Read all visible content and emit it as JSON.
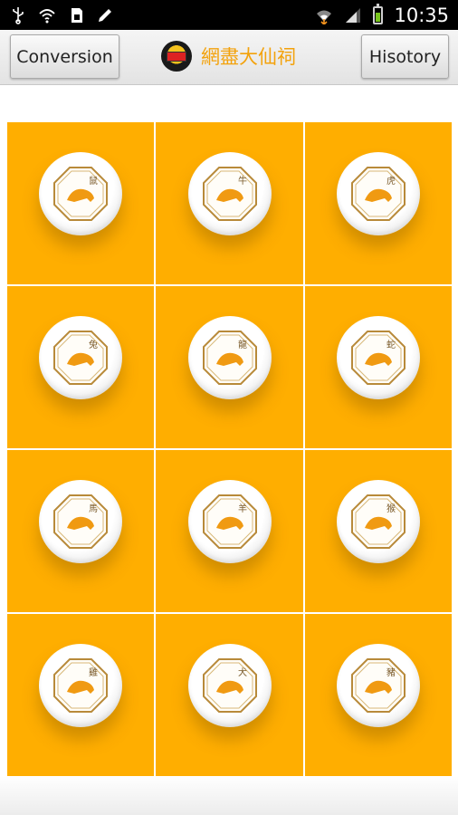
{
  "status_bar": {
    "time": "10:35",
    "icons": [
      "usb-icon",
      "wifi-icon",
      "sd-card-icon",
      "pencil-icon",
      "wifi-signal-icon",
      "cell-signal-icon",
      "battery-icon"
    ]
  },
  "action_bar": {
    "left_button": "Conversion",
    "title": "網盡大仙祠",
    "right_button": "Hisotory"
  },
  "zodiac": [
    {
      "name": "rat-icon",
      "label": "鼠"
    },
    {
      "name": "ox-icon",
      "label": "牛"
    },
    {
      "name": "tiger-icon",
      "label": "虎"
    },
    {
      "name": "rabbit-icon",
      "label": "兔"
    },
    {
      "name": "dragon-icon",
      "label": "龍"
    },
    {
      "name": "snake-icon",
      "label": "蛇"
    },
    {
      "name": "horse-icon",
      "label": "馬"
    },
    {
      "name": "goat-icon",
      "label": "羊"
    },
    {
      "name": "monkey-icon",
      "label": "猴"
    },
    {
      "name": "rooster-icon",
      "label": "雞"
    },
    {
      "name": "dog-icon",
      "label": "犬"
    },
    {
      "name": "pig-icon",
      "label": "豬"
    }
  ],
  "colors": {
    "cell_background": "#ffae00",
    "title": "#f3a20c",
    "emblem_border": "#b88a3a",
    "emblem_fill": "#f09a12"
  }
}
